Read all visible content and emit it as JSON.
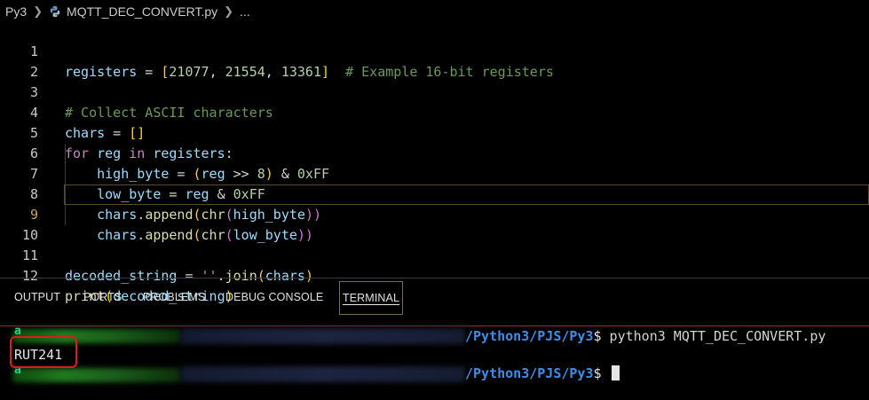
{
  "breadcrumb": {
    "folder": "Py3",
    "file": "MQTT_DEC_CONVERT.py",
    "more": "..."
  },
  "editor": {
    "active_line": 9,
    "lines": [
      {
        "n": "1"
      },
      {
        "n": "2"
      },
      {
        "n": "3"
      },
      {
        "n": "4"
      },
      {
        "n": "5"
      },
      {
        "n": "6"
      },
      {
        "n": "7"
      },
      {
        "n": "8"
      },
      {
        "n": "9"
      },
      {
        "n": "10"
      },
      {
        "n": "11"
      },
      {
        "n": "12"
      }
    ],
    "code": {
      "l1": {
        "a": "registers",
        "b": " = ",
        "c": "[",
        "d": "21077",
        "e": ", ",
        "f": "21554",
        "g": ", ",
        "h": "13361",
        "i": "]",
        "j": "  # Example 16-bit registers"
      },
      "l3": {
        "a": "# Collect ASCII characters"
      },
      "l4": {
        "a": "chars",
        "b": " = ",
        "c": "[]"
      },
      "l5": {
        "a": "for",
        "b": " ",
        "c": "reg",
        "d": " ",
        "e": "in",
        "f": " ",
        "g": "registers",
        "h": ":"
      },
      "l6": {
        "a": "    ",
        "b": "high_byte",
        "c": " = ",
        "d": "(",
        "e": "reg",
        "f": " >> ",
        "g": "8",
        "h": ")",
        "i": " & ",
        "j": "0xFF"
      },
      "l7": {
        "a": "    ",
        "b": "low_byte",
        "c": " = ",
        "d": "reg",
        "e": " & ",
        "f": "0xFF"
      },
      "l8": {
        "a": "    ",
        "b": "chars",
        "c": ".",
        "d": "append",
        "e": "(",
        "f": "chr",
        "g": "(",
        "h": "high_byte",
        "i": "))"
      },
      "l9": {
        "a": "    ",
        "b": "chars",
        "c": ".",
        "d": "append",
        "e": "(",
        "f": "chr",
        "g": "(",
        "h": "low_byte",
        "i": "))"
      },
      "l11": {
        "a": "decoded_string",
        "b": " = ",
        "c": "''",
        "d": ".",
        "e": "join",
        "f": "(",
        "g": "chars",
        "h": ")"
      },
      "l12": {
        "a": "print",
        "b": "(",
        "c": "decoded_string",
        "d": ")"
      }
    }
  },
  "panel": {
    "tabs": [
      "OUTPUT",
      "PORTS",
      "PROBLEMS",
      "DEBUG CONSOLE",
      "TERMINAL"
    ],
    "active_tab": "TERMINAL"
  },
  "terminal": {
    "prompt_user_initial": "a",
    "prompt_path": "/Python3/PJS/Py3",
    "prompt_symbol": "$",
    "command": " python3 MQTT_DEC_CONVERT.py",
    "output": "RUT241"
  },
  "colors": {
    "background": "#000000",
    "keyword": "#c586c0",
    "variable": "#9cdcfe",
    "number": "#b5cea8",
    "comment": "#6a9955",
    "function": "#dcdcaa",
    "path": "#3b8eea",
    "highlight_box": "#e01b1b"
  },
  "icons": {
    "breadcrumb_separator": "chevron-right-icon",
    "file_type": "python-icon"
  }
}
